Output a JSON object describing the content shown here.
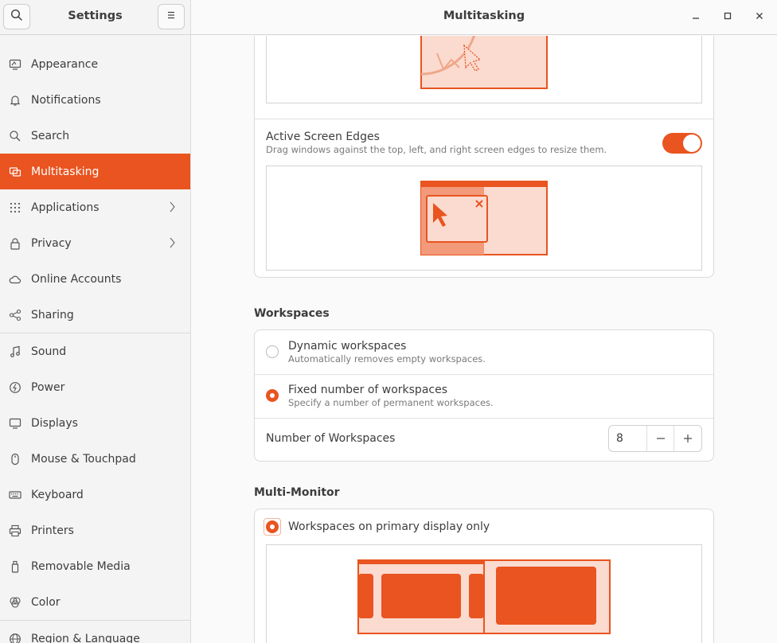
{
  "sidebar": {
    "title": "Settings",
    "items": [
      {
        "label": "Appearance",
        "icon": "appearance-icon"
      },
      {
        "label": "Notifications",
        "icon": "bell-icon"
      },
      {
        "label": "Search",
        "icon": "search-icon"
      },
      {
        "label": "Multitasking",
        "icon": "multitasking-icon",
        "active": true
      },
      {
        "label": "Applications",
        "icon": "apps-grid-icon",
        "chevron": true
      },
      {
        "label": "Privacy",
        "icon": "lock-icon",
        "chevron": true
      },
      {
        "label": "Online Accounts",
        "icon": "cloud-icon"
      },
      {
        "label": "Sharing",
        "icon": "share-icon"
      },
      {
        "label": "Sound",
        "icon": "music-note-icon"
      },
      {
        "label": "Power",
        "icon": "power-icon"
      },
      {
        "label": "Displays",
        "icon": "display-icon"
      },
      {
        "label": "Mouse & Touchpad",
        "icon": "mouse-icon"
      },
      {
        "label": "Keyboard",
        "icon": "keyboard-icon"
      },
      {
        "label": "Printers",
        "icon": "printer-icon"
      },
      {
        "label": "Removable Media",
        "icon": "usb-icon"
      },
      {
        "label": "Color",
        "icon": "color-icon"
      },
      {
        "label": "Region & Language",
        "icon": "globe-icon"
      }
    ]
  },
  "header": {
    "title": "Multitasking"
  },
  "general": {
    "active_edges_title": "Active Screen Edges",
    "active_edges_desc": "Drag windows against the top, left, and right screen edges to resize them.",
    "active_edges_on": true
  },
  "workspaces": {
    "section_title": "Workspaces",
    "dynamic_title": "Dynamic workspaces",
    "dynamic_desc": "Automatically removes empty workspaces.",
    "fixed_title": "Fixed number of workspaces",
    "fixed_desc": "Specify a number of permanent workspaces.",
    "selected": "fixed",
    "count_label": "Number of Workspaces",
    "count_value": "8"
  },
  "multimonitor": {
    "section_title": "Multi-Monitor",
    "primary_only_label": "Workspaces on primary display only",
    "primary_only_selected": true
  },
  "colors": {
    "accent": "#e95420",
    "accent_light": "#fbdbd0"
  }
}
